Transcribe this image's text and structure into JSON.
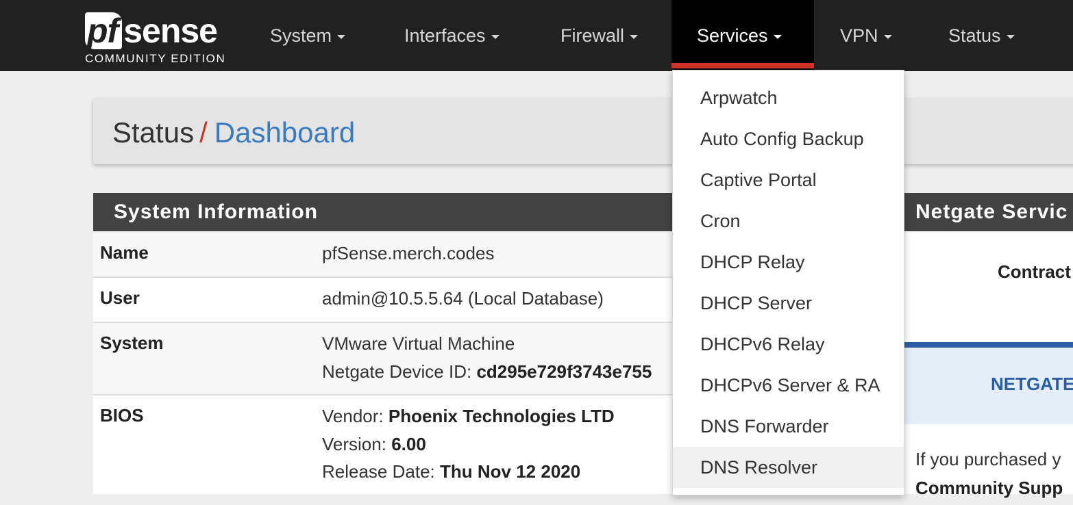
{
  "logo": {
    "brand_pf": "pf",
    "brand_sense": "sense",
    "edition": "COMMUNITY EDITION"
  },
  "nav": [
    {
      "label": "System"
    },
    {
      "label": "Interfaces"
    },
    {
      "label": "Firewall"
    },
    {
      "label": "Services"
    },
    {
      "label": "VPN"
    },
    {
      "label": "Status"
    }
  ],
  "active_nav": "Services",
  "breadcrumb": {
    "parent": "Status",
    "separator": "/",
    "current": "Dashboard"
  },
  "system_info": {
    "heading": "System Information",
    "rows": [
      {
        "label": "Name",
        "lines": [
          "pfSense.merch.codes"
        ]
      },
      {
        "label": "User",
        "lines": [
          "admin@10.5.5.64 (Local Database)"
        ]
      },
      {
        "label": "System",
        "line1": "VMware Virtual Machine",
        "device_id_label": "Netgate Device ID:",
        "device_id_value": "cd295e729f3743e755"
      },
      {
        "label": "BIOS",
        "vendor_label": "Vendor:",
        "vendor_value": "Phoenix Technologies LTD",
        "version_label": "Version:",
        "version_value": "6.00",
        "release_label": "Release Date:",
        "release_value": "Thu Nov 12 2020"
      }
    ]
  },
  "netgate_panel": {
    "heading": "Netgate Servic",
    "contract": "Contract",
    "banner": "NETGATE",
    "purchased_text": "If you purchased y",
    "community_text": "Community Supp"
  },
  "services_menu": {
    "items": [
      "Arpwatch",
      "Auto Config Backup",
      "Captive Portal",
      "Cron",
      "DHCP Relay",
      "DHCP Server",
      "DHCPv6 Relay",
      "DHCPv6 Server & RA",
      "DNS Forwarder",
      "DNS Resolver"
    ],
    "highlighted": "DNS Resolver"
  },
  "colors": {
    "navbar": "#212121",
    "active_accent": "#d03326",
    "link_blue": "#3a7bbf",
    "panel_heading": "#424242"
  }
}
